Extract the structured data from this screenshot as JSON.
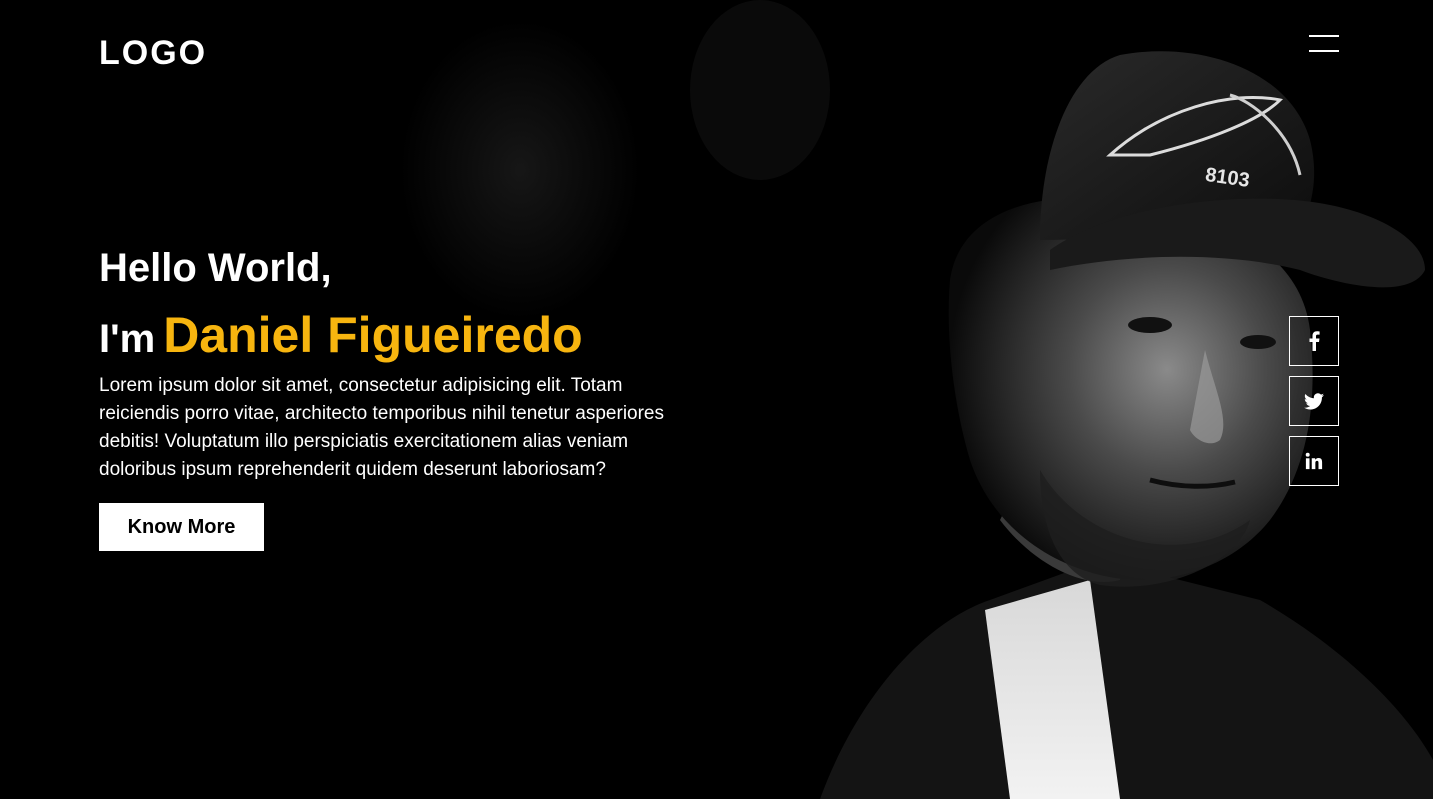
{
  "header": {
    "logo": "LOGO",
    "menu_icon": "hamburger-menu-icon"
  },
  "hero": {
    "greeting": "Hello World,",
    "intro_prefix": "I'm",
    "name": "Daniel Figueiredo",
    "description": "Lorem ipsum dolor sit amet, consectetur adipisicing elit. Totam reiciendis porro vitae, architecto temporibus nihil tenetur asperiores debitis! Voluptatum illo perspiciatis exercitationem alias veniam doloribus ipsum reprehenderit quidem deserunt laboriosam?",
    "cta_label": "Know More",
    "cap_text": "8103"
  },
  "social": [
    {
      "icon": "facebook-icon"
    },
    {
      "icon": "twitter-icon"
    },
    {
      "icon": "linkedin-icon"
    }
  ],
  "colors": {
    "background": "#000000",
    "accent": "#f7b50f",
    "text": "#ffffff"
  }
}
